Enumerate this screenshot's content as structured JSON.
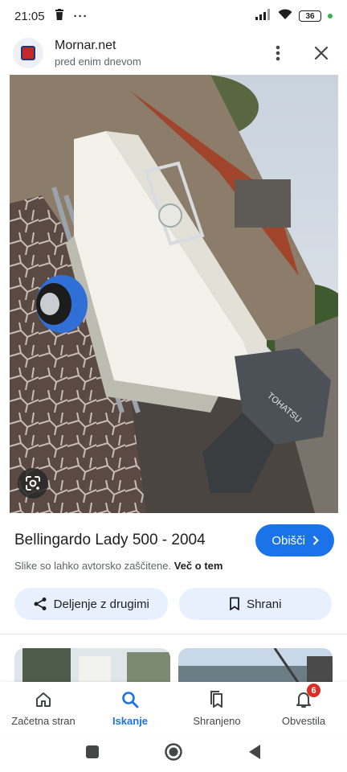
{
  "status_bar": {
    "time": "21:05",
    "more": "···",
    "battery": "36"
  },
  "header": {
    "site_name": "Mornar.net",
    "posted_time": "pred enim dnevom"
  },
  "image": {
    "brand_text": "TOHATSU"
  },
  "result": {
    "title": "Bellingardo Lady 500 - 2004",
    "visit_label": "Obišči",
    "copyright_text": "Slike so lahko avtorsko zaščitene.",
    "learn_more": "Več o tem"
  },
  "actions": {
    "share_label": "Deljenje z drugimi",
    "save_label": "Shrani"
  },
  "bottom_nav": {
    "items": [
      {
        "label": "Začetna stran",
        "icon": "home-icon"
      },
      {
        "label": "Iskanje",
        "icon": "search-icon"
      },
      {
        "label": "Shranjeno",
        "icon": "saved-icon"
      },
      {
        "label": "Obvestila",
        "icon": "bell-icon",
        "badge": "6"
      }
    ]
  },
  "colors": {
    "accent": "#1a73e8",
    "chip_bg": "#e8f0fe",
    "badge": "#d93025"
  }
}
